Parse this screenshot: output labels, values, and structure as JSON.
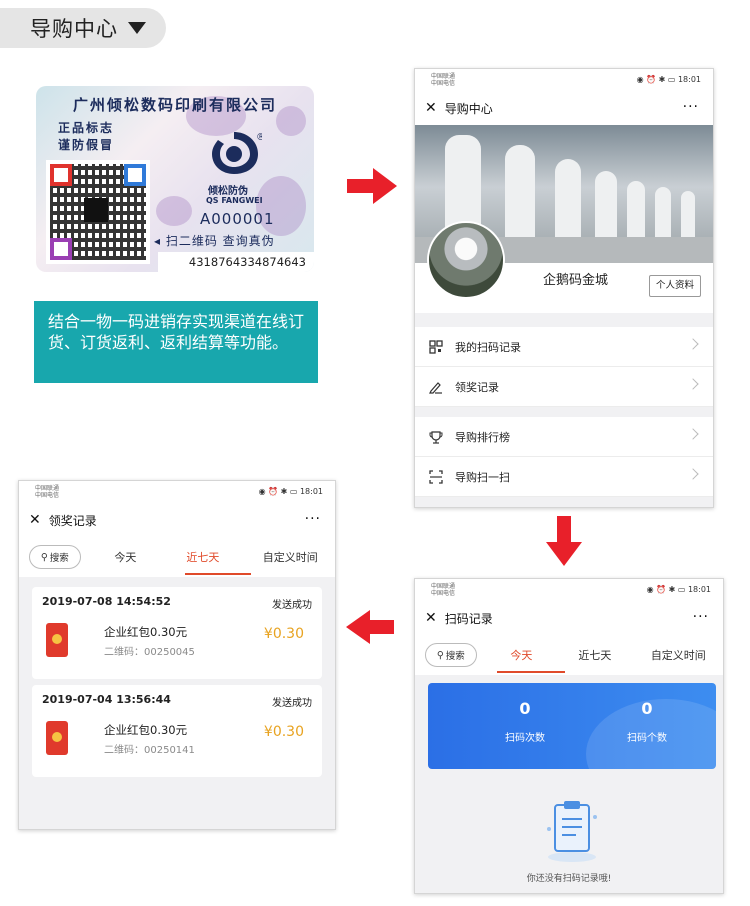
{
  "header": {
    "title": "导购中心"
  },
  "label": {
    "company": "广州倾松数码印刷有限公司",
    "line1": "正品标志",
    "line2": "谨防假冒",
    "brand_cn": "倾松防伪",
    "brand_en": "QS FANGWEI",
    "serial": "A000001",
    "scan_hint": "扫二维码 查询真伪",
    "code": "4318764334874643",
    "registered": "®"
  },
  "description": "结合一物一码进销存实现渠道在线订货、订货返利、返利结算等功能。",
  "status_bar": {
    "carrier1": "中国联通",
    "carrier2": "中国电信",
    "time": "18:01"
  },
  "panel1": {
    "title": "导购中心",
    "profile_name": "企鹅码金城",
    "profile_button": "个人资料",
    "menu": [
      {
        "label": "我的扫码记录",
        "icon": "qr-icon"
      },
      {
        "label": "领奖记录",
        "icon": "pen-icon"
      },
      {
        "label": "导购排行榜",
        "icon": "trophy-icon"
      },
      {
        "label": "导购扫一扫",
        "icon": "scan-icon"
      }
    ]
  },
  "panel3": {
    "title": "扫码记录",
    "search": "搜索",
    "tabs": [
      "今天",
      "近七天",
      "自定义时间"
    ],
    "stats": [
      {
        "value": "0",
        "label": "扫码次数"
      },
      {
        "value": "0",
        "label": "扫码个数"
      }
    ],
    "empty_text": "你还没有扫码记录哦!"
  },
  "panel2": {
    "title": "领奖记录",
    "search": "搜索",
    "tabs": [
      "今天",
      "近七天",
      "自定义时间"
    ],
    "records": [
      {
        "date": "2019-07-08 14:54:52",
        "status": "发送成功",
        "name": "企业红包0.30元",
        "code": "二维码：00250045",
        "amount": "¥0.30"
      },
      {
        "date": "2019-07-04 13:56:44",
        "status": "发送成功",
        "name": "企业红包0.30元",
        "code": "二维码：00250141",
        "amount": "¥0.30"
      }
    ]
  },
  "colors": {
    "accent": "#e04a2a",
    "teal": "#18a7ad",
    "arrow": "#e8202a",
    "gold": "#e8a321"
  }
}
